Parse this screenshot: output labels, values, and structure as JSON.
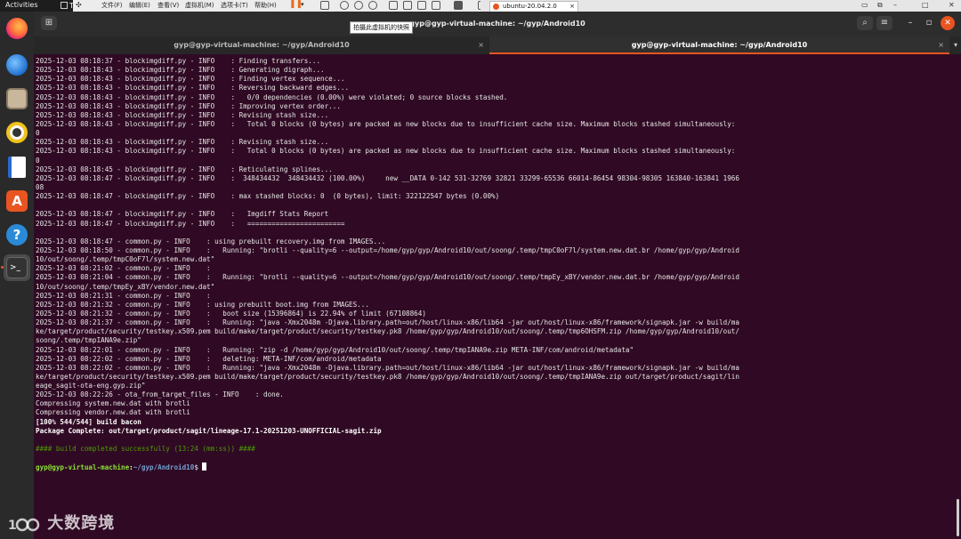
{
  "topbar": {
    "activities": "Activities",
    "te_tab": "Te"
  },
  "vmware": {
    "menus": [
      "文件(F)",
      "编辑(E)",
      "查看(V)",
      "虚拟机(M)",
      "选项卡(T)",
      "帮助(H)"
    ],
    "tab_label": "ubuntu-20.04.2.0",
    "tooltip": "拍摄此虚拟机的快照"
  },
  "terminal": {
    "window_title": "gyp@gyp-virtual-machine: ~/gyp/Android10",
    "tabs": [
      {
        "label": "gyp@gyp-virtual-machine: ~/gyp/Android10"
      },
      {
        "label": "gyp@gyp-virtual-machine: ~/gyp/Android10"
      }
    ],
    "lines": [
      "2025-12-03 08:18:37 - blockimgdiff.py - INFO    : Finding transfers...",
      "2025-12-03 08:18:43 - blockimgdiff.py - INFO    : Generating digraph...",
      "2025-12-03 08:18:43 - blockimgdiff.py - INFO    : Finding vertex sequence...",
      "2025-12-03 08:18:43 - blockimgdiff.py - INFO    : Reversing backward edges...",
      "2025-12-03 08:18:43 - blockimgdiff.py - INFO    :   0/0 dependencies (0.00%) were violated; 0 source blocks stashed.",
      "2025-12-03 08:18:43 - blockimgdiff.py - INFO    : Improving vertex order...",
      "2025-12-03 08:18:43 - blockimgdiff.py - INFO    : Revising stash size...",
      "2025-12-03 08:18:43 - blockimgdiff.py - INFO    :   Total 0 blocks (0 bytes) are packed as new blocks due to insufficient cache size. Maximum blocks stashed simultaneously:",
      "0",
      "2025-12-03 08:18:43 - blockimgdiff.py - INFO    : Revising stash size...",
      "2025-12-03 08:18:43 - blockimgdiff.py - INFO    :   Total 0 blocks (0 bytes) are packed as new blocks due to insufficient cache size. Maximum blocks stashed simultaneously:",
      "0",
      "2025-12-03 08:18:45 - blockimgdiff.py - INFO    : Reticulating splines...",
      "2025-12-03 08:18:47 - blockimgdiff.py - INFO    :  348434432  348434432 (100.00%)     new __DATA 0-142 531-32769 32821 33299-65536 66014-86454 98304-98305 163840-163841 1966",
      "08",
      "2025-12-03 08:18:47 - blockimgdiff.py - INFO    : max stashed blocks: 0  (0 bytes), limit: 322122547 bytes (0.00%)",
      "",
      "2025-12-03 08:18:47 - blockimgdiff.py - INFO    :   Imgdiff Stats Report",
      "2025-12-03 08:18:47 - blockimgdiff.py - INFO    :   ========================",
      "",
      "2025-12-03 08:18:47 - common.py - INFO    : using prebuilt recovery.img from IMAGES...",
      "2025-12-03 08:18:50 - common.py - INFO    :   Running: \"brotli --quality=6 --output=/home/gyp/gyp/Android10/out/soong/.temp/tmpC0oF7l/system.new.dat.br /home/gyp/gyp/Android",
      "10/out/soong/.temp/tmpC0oF7l/system.new.dat\"",
      "2025-12-03 08:21:02 - common.py - INFO    :",
      "2025-12-03 08:21:04 - common.py - INFO    :   Running: \"brotli --quality=6 --output=/home/gyp/gyp/Android10/out/soong/.temp/tmpEy_xBY/vendor.new.dat.br /home/gyp/gyp/Android",
      "10/out/soong/.temp/tmpEy_xBY/vendor.new.dat\"",
      "2025-12-03 08:21:31 - common.py - INFO    :",
      "2025-12-03 08:21:32 - common.py - INFO    : using prebuilt boot.img from IMAGES...",
      "2025-12-03 08:21:32 - common.py - INFO    :   boot size (15396864) is 22.94% of limit (67108864)",
      "2025-12-03 08:21:37 - common.py - INFO    :   Running: \"java -Xmx2048m -Djava.library.path=out/host/linux-x86/lib64 -jar out/host/linux-x86/framework/signapk.jar -w build/ma",
      "ke/target/product/security/testkey.x509.pem build/make/target/product/security/testkey.pk8 /home/gyp/gyp/Android10/out/soong/.temp/tmp6OHSFM.zip /home/gyp/gyp/Android10/out/",
      "soong/.temp/tmpIANA9e.zip\"",
      "2025-12-03 08:22:01 - common.py - INFO    :   Running: \"zip -d /home/gyp/gyp/Android10/out/soong/.temp/tmpIANA9e.zip META-INF/com/android/metadata\"",
      "2025-12-03 08:22:02 - common.py - INFO    :   deleting: META-INF/com/android/metadata",
      "2025-12-03 08:22:02 - common.py - INFO    :   Running: \"java -Xmx2048m -Djava.library.path=out/host/linux-x86/lib64 -jar out/host/linux-x86/framework/signapk.jar -w build/ma",
      "ke/target/product/security/testkey.x509.pem build/make/target/product/security/testkey.pk8 /home/gyp/gyp/Android10/out/soong/.temp/tmpIANA9e.zip out/target/product/sagit/lin",
      "eage_sagit-ota-eng.gyp.zip\"",
      "2025-12-03 08:22:26 - ota_from_target_files - INFO    : done.",
      "Compressing system.new.dat with brotli",
      "Compressing vendor.new.dat with brotli",
      "[100% 544/544] build bacon",
      "Package Complete: out/target/product/sagit/lineage-17.1-20251203-UNOFFICIAL-sagit.zip",
      "",
      "#### build completed successfully (13:24 (mm:ss)) ####",
      ""
    ],
    "prompt": {
      "user_host": "gyp@gyp-virtual-machine",
      "sep": ":",
      "path": "~/gyp/Android10",
      "symbol": "$ "
    }
  },
  "watermark": {
    "text": "大数跨境"
  },
  "colors": {
    "terminal_bg": "#300a24",
    "accent": "#e95420",
    "prompt_user": "#8ae234",
    "prompt_path": "#729fcf",
    "success": "#4e9a06"
  }
}
